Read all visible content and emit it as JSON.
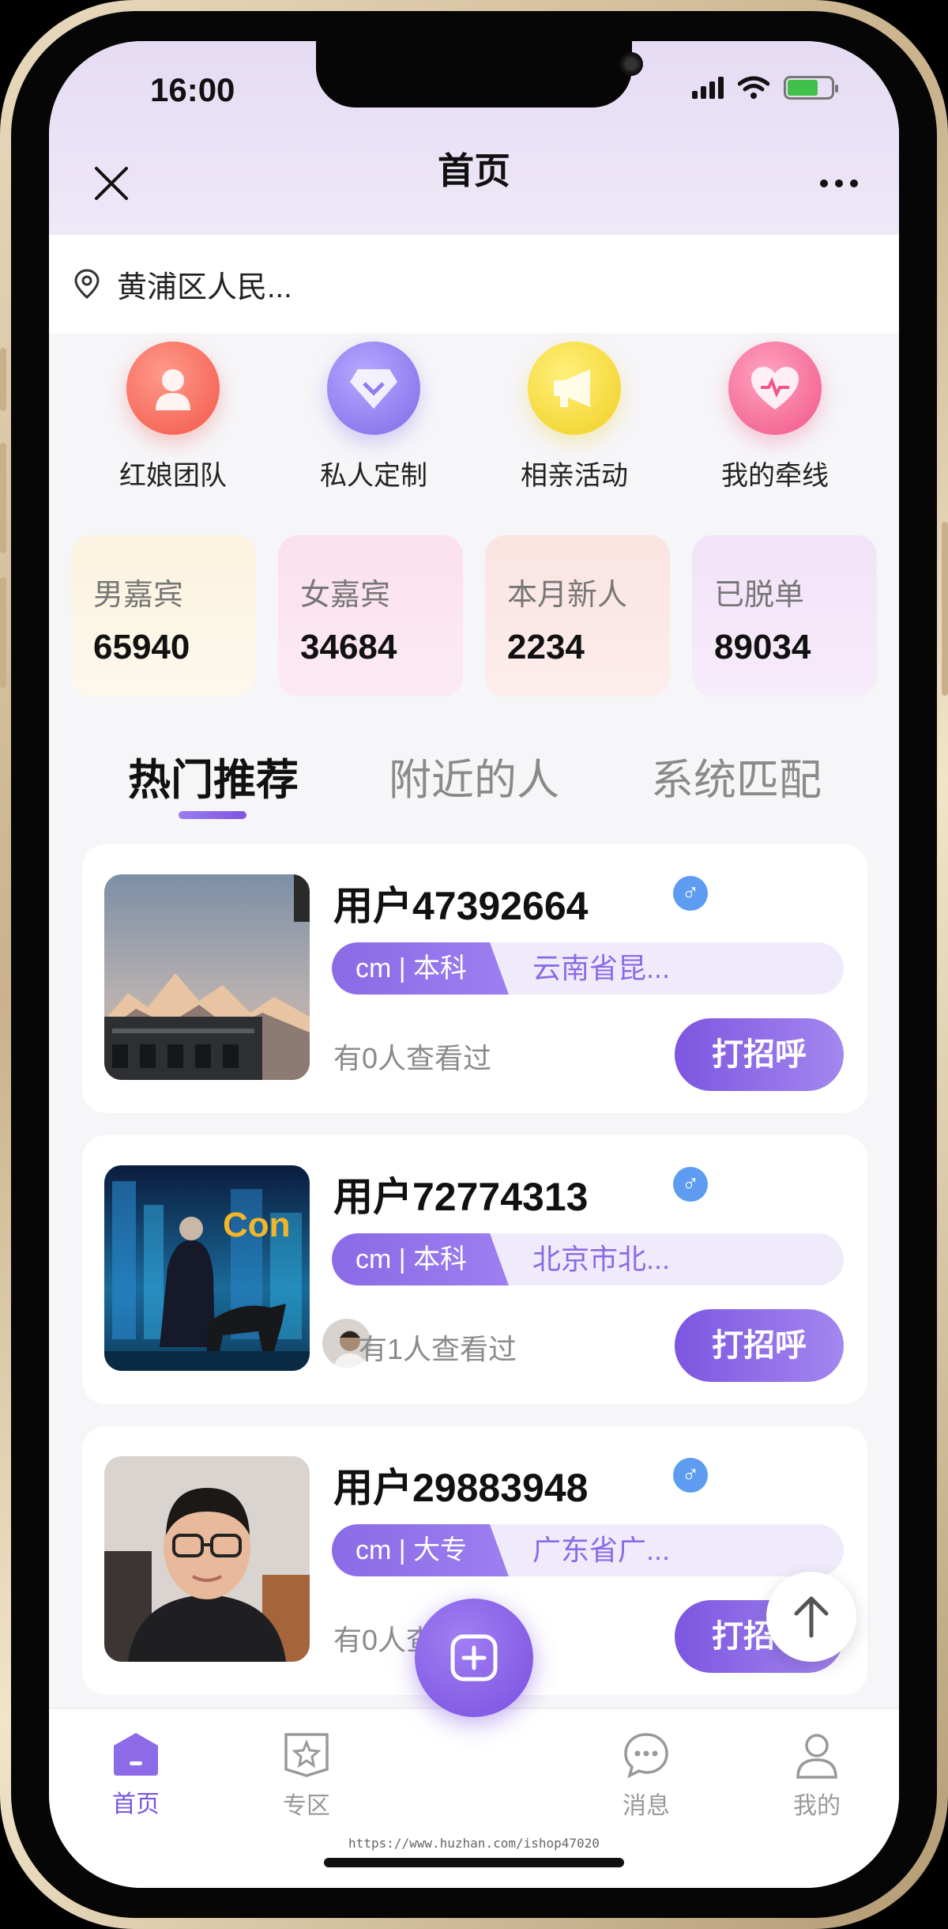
{
  "status_bar": {
    "time": "16:00"
  },
  "header": {
    "title": "首页"
  },
  "location": {
    "text": "黄浦区人民..."
  },
  "quick_menu": [
    {
      "label": "红娘团队",
      "icon": "matchmaker-icon",
      "color": "#f56a5c"
    },
    {
      "label": "私人定制",
      "icon": "diamond-icon",
      "color": "#8f7cf0"
    },
    {
      "label": "相亲活动",
      "icon": "megaphone-icon",
      "color": "#f0d33a"
    },
    {
      "label": "我的牵线",
      "icon": "heart-icon",
      "color": "#f0648e"
    }
  ],
  "stats": [
    {
      "label": "男嘉宾",
      "value": "65940",
      "color": "#fbf3df"
    },
    {
      "label": "女嘉宾",
      "value": "34684",
      "color": "#fbe3ef"
    },
    {
      "label": "本月新人",
      "value": "2234",
      "color": "#fbe8e6"
    },
    {
      "label": "已脱单",
      "value": "89034",
      "color": "#f3e6f8"
    }
  ],
  "tabs": [
    {
      "label": "热门推荐",
      "active": true
    },
    {
      "label": "附近的人",
      "active": false
    },
    {
      "label": "系统匹配",
      "active": false
    }
  ],
  "users": [
    {
      "name": "用户47392664",
      "gender": "♂",
      "height": "cm",
      "education": "本科",
      "location": "云南省昆...",
      "viewers": "有0人查看过",
      "button": "打招呼"
    },
    {
      "name": "用户72774313",
      "gender": "♂",
      "height": "cm",
      "education": "本科",
      "location": "北京市北...",
      "viewers": "有1人查看过",
      "button": "打招呼"
    },
    {
      "name": "用户29883948",
      "gender": "♂",
      "height": "cm",
      "education": "大专",
      "location": "广东省广...",
      "viewers": "有0人查看过",
      "button": "打招呼"
    }
  ],
  "bottom_nav": [
    {
      "label": "首页",
      "icon": "home-icon",
      "active": true
    },
    {
      "label": "专区",
      "icon": "star-square-icon",
      "active": false
    },
    {
      "label": "消息",
      "icon": "chat-icon",
      "active": false
    },
    {
      "label": "我的",
      "icon": "profile-icon",
      "active": false
    }
  ],
  "watermark": "https://www.huzhan.com/ishop47020",
  "accent_color": "#7a57e0"
}
